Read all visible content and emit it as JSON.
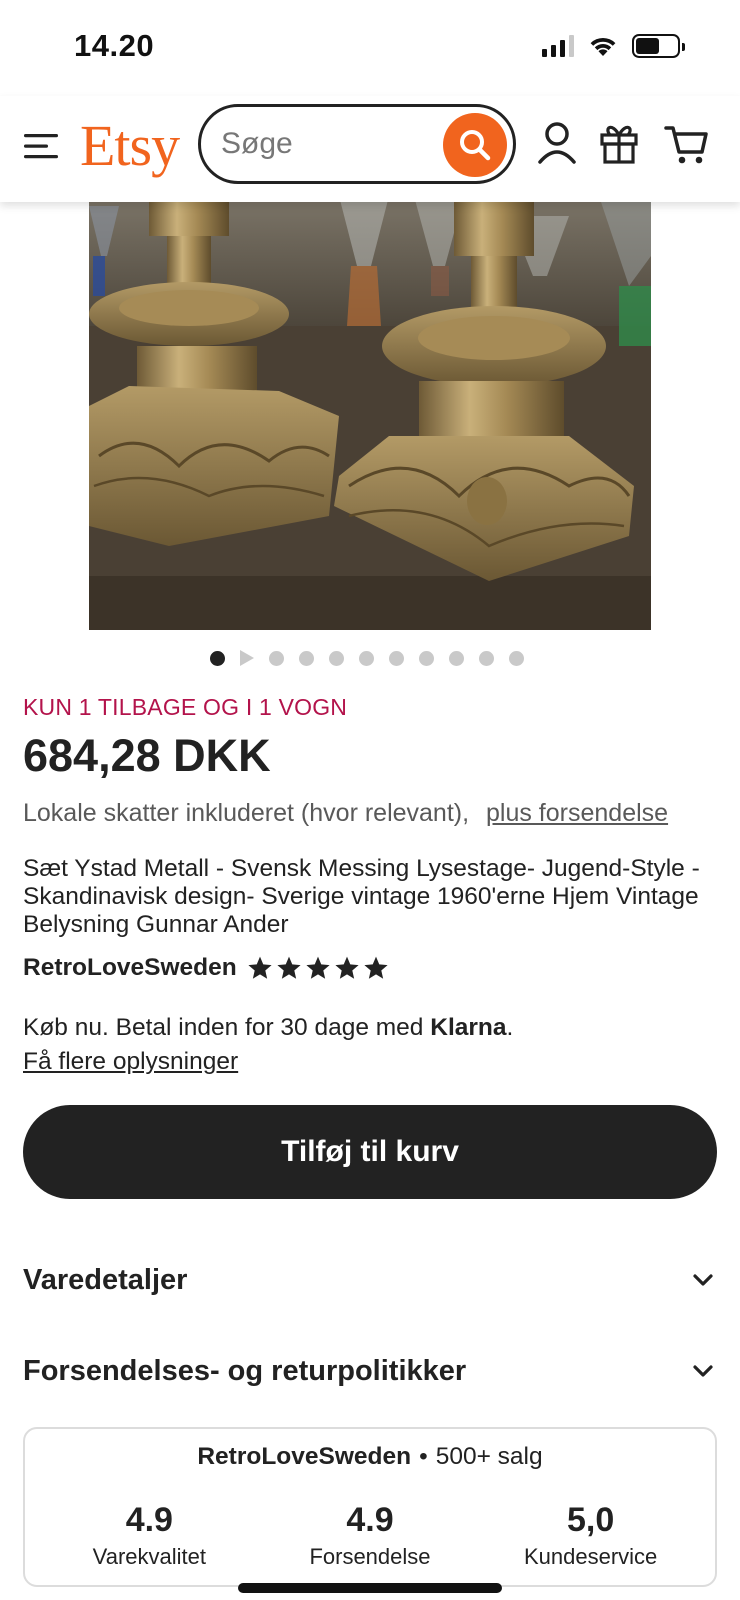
{
  "status_bar": {
    "time": "14.20"
  },
  "header": {
    "logo": "Etsy",
    "search": {
      "placeholder": "Søge",
      "value": ""
    },
    "accent_color": "#f1641e"
  },
  "product": {
    "image_alt": "",
    "carousel": {
      "total_dots": 11,
      "active_index": 0,
      "has_video": true
    },
    "stock_notice": "KUN 1 TILBAGE OG I 1 VOGN",
    "price": "684,28 DKK",
    "tax_note": "Lokale skatter inkluderet (hvor relevant),",
    "shipping_link": "plus forsendelse",
    "title": "Sæt Ystad Metall - Svensk Messing Lysestage- Jugend-Style - Skandinavisk design- Sverige vintage 1960'erne Hjem Vintage Belysning Gunnar Ander",
    "shop_name": "RetroLoveSweden",
    "star_rating": 5
  },
  "klarna": {
    "text_prefix": "Køb nu. Betal inden for 30 dage med",
    "brand": "Klarna",
    "text_suffix": ".",
    "more_info_link": "Få flere oplysninger"
  },
  "add_to_cart_label": "Tilføj til kurv",
  "accordions": [
    {
      "label": "Varedetaljer"
    },
    {
      "label": "Forsendelses- og returpolitikker"
    }
  ],
  "shop_card": {
    "name": "RetroLoveSweden",
    "separator": "•",
    "sales": "500+ salg",
    "ratings": [
      {
        "value": "4.9",
        "label": "Varekvalitet"
      },
      {
        "value": "4.9",
        "label": "Forsendelse"
      },
      {
        "value": "5,0",
        "label": "Kundeservice"
      }
    ]
  },
  "colors": {
    "brand_orange": "#f1641e",
    "stock_red": "#b3134b",
    "button_dark": "#222222"
  }
}
